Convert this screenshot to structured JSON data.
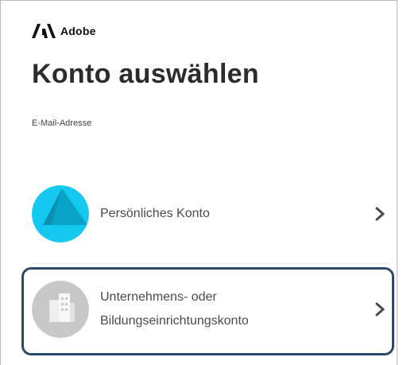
{
  "brand": {
    "name": "Adobe",
    "logo_icon": "adobe-logo-icon"
  },
  "page": {
    "title": "Konto auswählen"
  },
  "email": {
    "label": "E-Mail-Adresse"
  },
  "accounts": [
    {
      "label": "Persönliches Konto",
      "icon": "personal-account-avatar-icon",
      "color": "#14c8f0"
    },
    {
      "label_line1": "Unternehmens- oder",
      "label_line2": "Bildungseinrichtungskonto",
      "icon": "building-icon",
      "color": "#c8c8c8"
    }
  ],
  "colors": {
    "highlight": "#2b4a6b",
    "text": "#2c2c2c"
  }
}
